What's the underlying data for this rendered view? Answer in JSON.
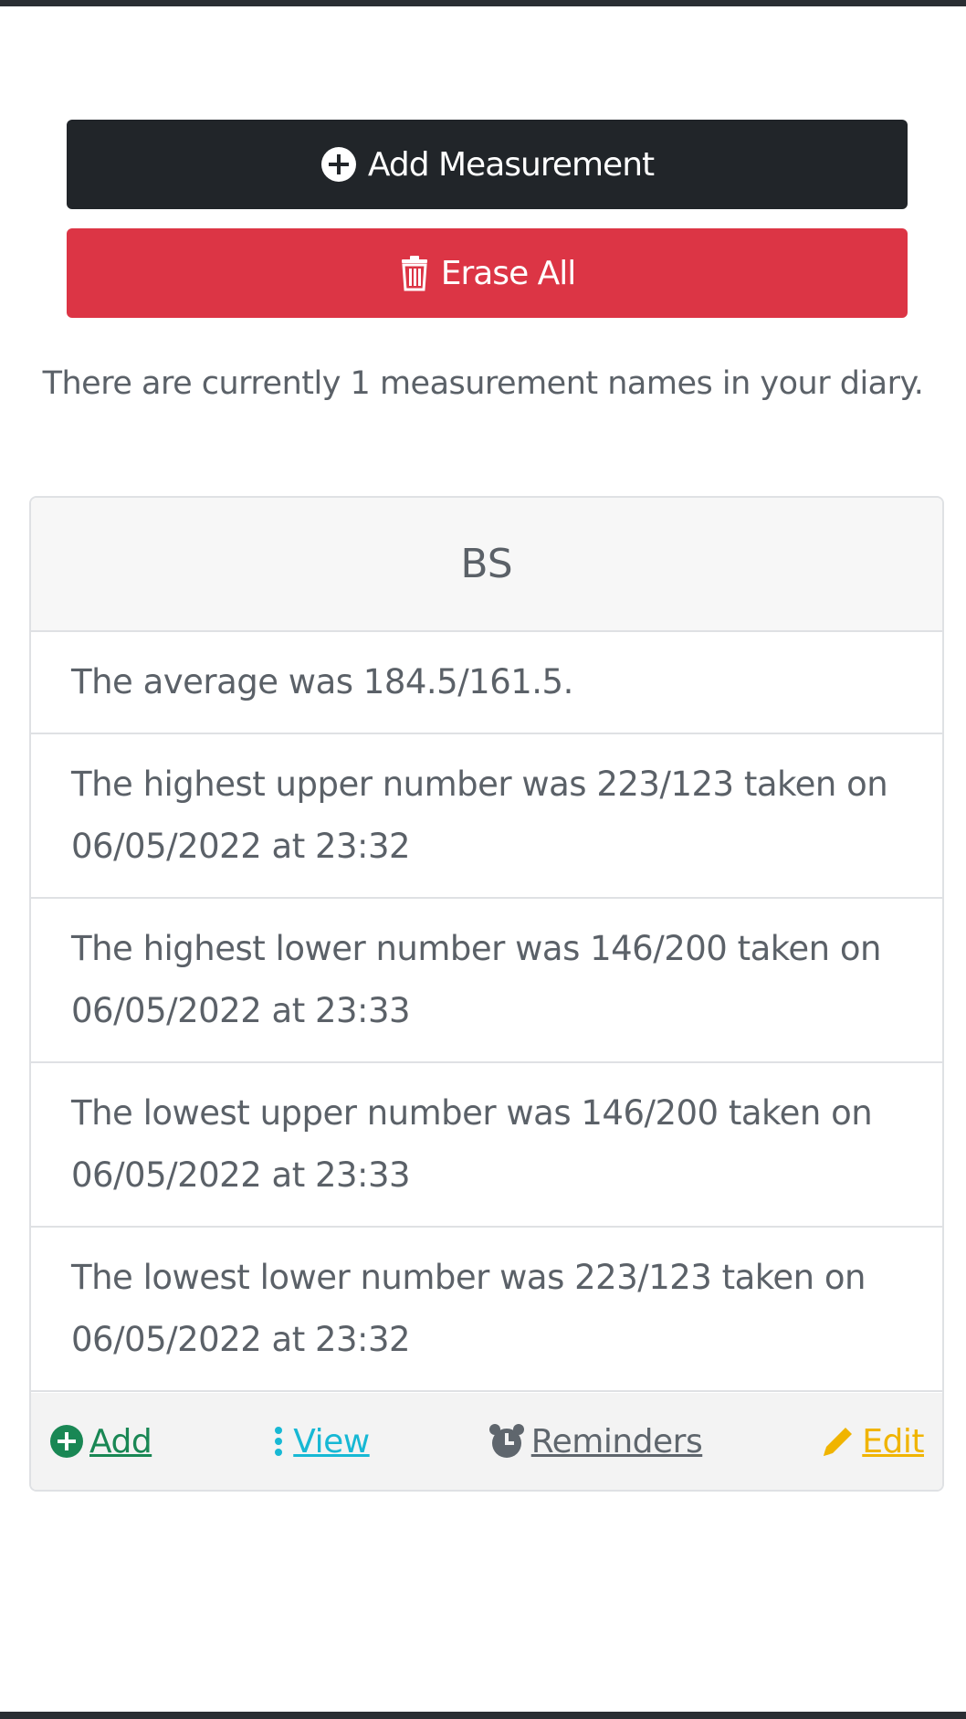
{
  "actions": {
    "add_measurement_label": "Add Measurement",
    "erase_all_label": "Erase All"
  },
  "summary_text": "There are currently 1 measurement names in your diary.",
  "card": {
    "title": "BS",
    "stats": [
      "The average was 184.5/161.5.",
      "The highest upper number was 223/123 taken on 06/05/2022 at 23:32",
      "The highest lower number was 146/200 taken on 06/05/2022 at 23:33",
      "The lowest upper number was 146/200 taken on 06/05/2022 at 23:33",
      "The lowest lower number was 223/123 taken on 06/05/2022 at 23:32"
    ],
    "footer": {
      "add_label": "Add",
      "view_label": "View",
      "reminders_label": "Reminders",
      "edit_label": "Edit"
    }
  },
  "colors": {
    "dark_button": "#212529",
    "danger_button": "#dc3545",
    "add_link": "#198754",
    "view_link": "#17b8d4",
    "reminders_link": "#5f666d",
    "edit_link": "#f0b400"
  },
  "icons": {
    "add_measurement": "plus-circle-icon",
    "erase_all": "trash-icon",
    "add": "plus-circle-icon",
    "view": "vertical-dots-icon",
    "reminders": "alarm-clock-icon",
    "edit": "pencil-icon"
  }
}
